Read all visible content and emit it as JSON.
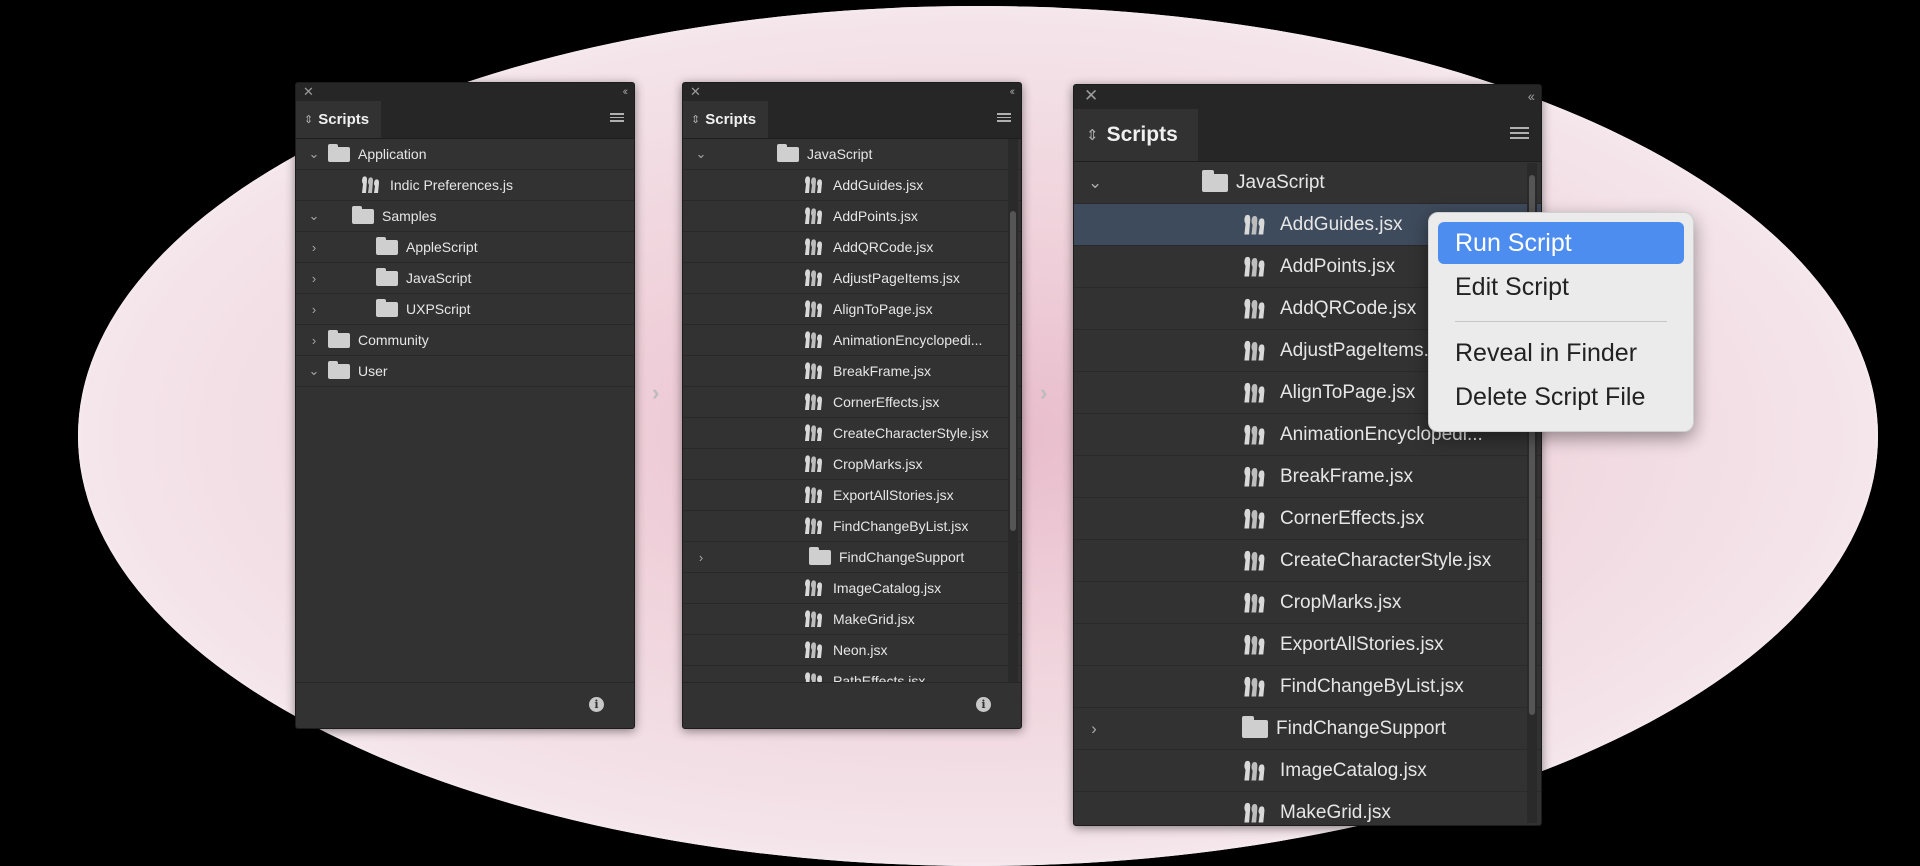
{
  "panel1": {
    "close": "✕",
    "collapse": "‹‹",
    "tab": "Scripts",
    "rows": [
      {
        "label": "Application",
        "type": "folder",
        "chev": "⌄",
        "indent": 0
      },
      {
        "label": "Indic Preferences.js",
        "type": "script",
        "chev": "",
        "indent": 1
      },
      {
        "label": "Samples",
        "type": "folder",
        "chev": "⌄",
        "indent": 1
      },
      {
        "label": "AppleScript",
        "type": "folder",
        "chev": "›",
        "indent": 2
      },
      {
        "label": "JavaScript",
        "type": "folder",
        "chev": "›",
        "indent": 2
      },
      {
        "label": "UXPScript",
        "type": "folder",
        "chev": "›",
        "indent": 2
      },
      {
        "label": "Community",
        "type": "folder",
        "chev": "›",
        "indent": 0
      },
      {
        "label": "User",
        "type": "folder",
        "chev": "⌄",
        "indent": 0
      }
    ]
  },
  "panel2": {
    "close": "✕",
    "collapse": "‹‹",
    "tab": "Scripts",
    "rows": [
      {
        "label": "JavaScript",
        "type": "folder",
        "chev": "⌄",
        "indent": 0
      },
      {
        "label": "AddGuides.jsx",
        "type": "script",
        "chev": "",
        "indent": 1
      },
      {
        "label": "AddPoints.jsx",
        "type": "script",
        "chev": "",
        "indent": 1
      },
      {
        "label": "AddQRCode.jsx",
        "type": "script",
        "chev": "",
        "indent": 1
      },
      {
        "label": "AdjustPageItems.jsx",
        "type": "script",
        "chev": "",
        "indent": 1
      },
      {
        "label": "AlignToPage.jsx",
        "type": "script",
        "chev": "",
        "indent": 1
      },
      {
        "label": "AnimationEncyclopedi...",
        "type": "script",
        "chev": "",
        "indent": 1
      },
      {
        "label": "BreakFrame.jsx",
        "type": "script",
        "chev": "",
        "indent": 1
      },
      {
        "label": "CornerEffects.jsx",
        "type": "script",
        "chev": "",
        "indent": 1
      },
      {
        "label": "CreateCharacterStyle.jsx",
        "type": "script",
        "chev": "",
        "indent": 1
      },
      {
        "label": "CropMarks.jsx",
        "type": "script",
        "chev": "",
        "indent": 1
      },
      {
        "label": "ExportAllStories.jsx",
        "type": "script",
        "chev": "",
        "indent": 1
      },
      {
        "label": "FindChangeByList.jsx",
        "type": "script",
        "chev": "",
        "indent": 1
      },
      {
        "label": "FindChangeSupport",
        "type": "folder",
        "chev": "›",
        "indent": 1
      },
      {
        "label": "ImageCatalog.jsx",
        "type": "script",
        "chev": "",
        "indent": 1
      },
      {
        "label": "MakeGrid.jsx",
        "type": "script",
        "chev": "",
        "indent": 1
      },
      {
        "label": "Neon.jsx",
        "type": "script",
        "chev": "",
        "indent": 1
      },
      {
        "label": "PathEffects.jsx",
        "type": "script",
        "chev": "",
        "indent": 1
      }
    ]
  },
  "panel3": {
    "close": "✕",
    "collapse": "‹‹",
    "tab": "Scripts",
    "rows": [
      {
        "label": "JavaScript",
        "type": "folder",
        "chev": "⌄",
        "indent": 0
      },
      {
        "label": "AddGuides.jsx",
        "type": "script",
        "chev": "",
        "indent": 1,
        "selected": true
      },
      {
        "label": "AddPoints.jsx",
        "type": "script",
        "chev": "",
        "indent": 1
      },
      {
        "label": "AddQRCode.jsx",
        "type": "script",
        "chev": "",
        "indent": 1
      },
      {
        "label": "AdjustPageItems.jsx",
        "type": "script",
        "chev": "",
        "indent": 1
      },
      {
        "label": "AlignToPage.jsx",
        "type": "script",
        "chev": "",
        "indent": 1
      },
      {
        "label": "AnimationEncyclopedi...",
        "type": "script",
        "chev": "",
        "indent": 1
      },
      {
        "label": "BreakFrame.jsx",
        "type": "script",
        "chev": "",
        "indent": 1
      },
      {
        "label": "CornerEffects.jsx",
        "type": "script",
        "chev": "",
        "indent": 1
      },
      {
        "label": "CreateCharacterStyle.jsx",
        "type": "script",
        "chev": "",
        "indent": 1
      },
      {
        "label": "CropMarks.jsx",
        "type": "script",
        "chev": "",
        "indent": 1
      },
      {
        "label": "ExportAllStories.jsx",
        "type": "script",
        "chev": "",
        "indent": 1
      },
      {
        "label": "FindChangeByList.jsx",
        "type": "script",
        "chev": "",
        "indent": 1
      },
      {
        "label": "FindChangeSupport",
        "type": "folder",
        "chev": "›",
        "indent": 1
      },
      {
        "label": "ImageCatalog.jsx",
        "type": "script",
        "chev": "",
        "indent": 1
      },
      {
        "label": "MakeGrid.jsx",
        "type": "script",
        "chev": "",
        "indent": 1
      }
    ]
  },
  "arrows": [
    "›",
    "›"
  ],
  "context_menu": {
    "items": [
      "Run Script",
      "Edit Script",
      "Reveal in Finder",
      "Delete Script File"
    ],
    "highlighted": "Run Script"
  },
  "info_icon": "i",
  "colors": {
    "panel_bg": "#323232",
    "selected_row": "#3e4b5c",
    "menu_highlight": "#4e8df0",
    "backdrop": "#f0d3dc"
  }
}
